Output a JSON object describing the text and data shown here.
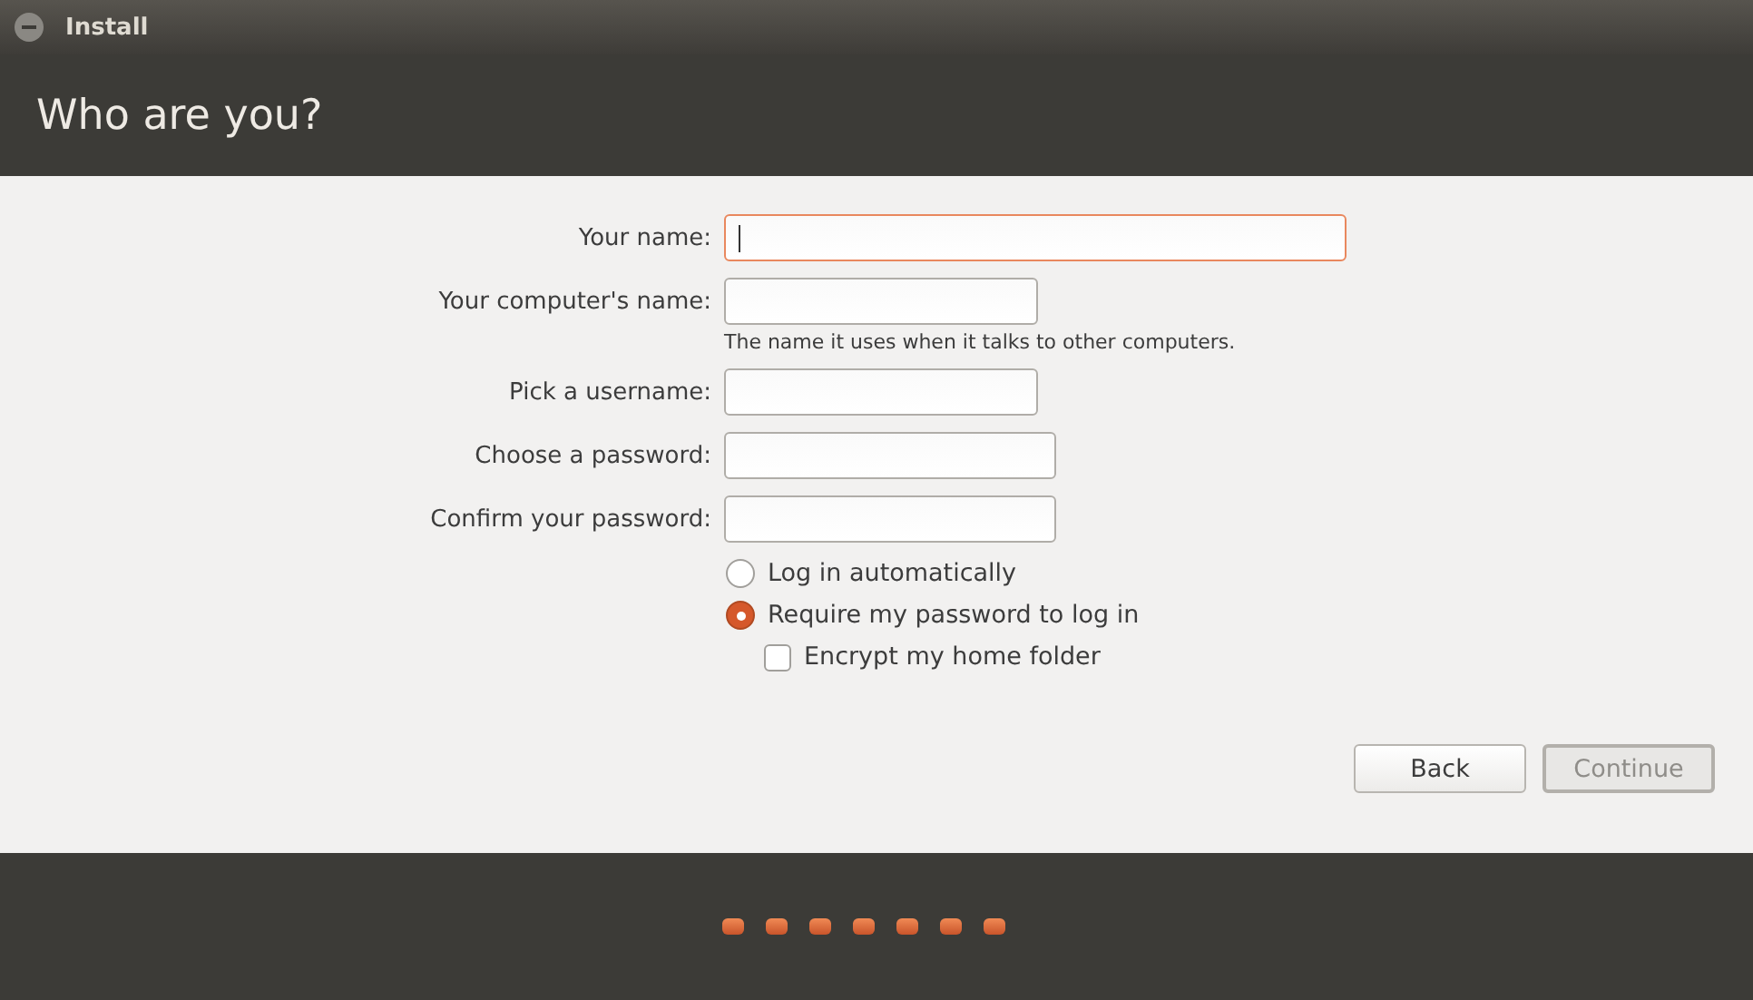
{
  "window": {
    "title": "Install"
  },
  "heading": "Who are you?",
  "fields": [
    {
      "label": "Your name:",
      "kind": "wide",
      "focused": true
    },
    {
      "label": "Your computer's name:",
      "kind": "short",
      "focused": false,
      "hint": "The name it uses when it talks to other computers."
    },
    {
      "label": "Pick a username:",
      "kind": "short",
      "focused": false
    },
    {
      "label": "Choose a password:",
      "kind": "medium",
      "focused": false
    },
    {
      "label": "Confirm your password:",
      "kind": "medium",
      "focused": false
    }
  ],
  "login_options": [
    {
      "label": "Log in automatically",
      "selected": false
    },
    {
      "label": "Require my password to log in",
      "selected": true
    }
  ],
  "encrypt": {
    "label": "Encrypt my home folder",
    "checked": false
  },
  "buttons": [
    {
      "label": "Back",
      "disabled": false
    },
    {
      "label": "Continue",
      "disabled": true
    }
  ],
  "progress_dots": [
    {
      "current": false
    },
    {
      "current": false
    },
    {
      "current": false
    },
    {
      "current": false
    },
    {
      "current": false
    },
    {
      "current": false
    },
    {
      "current": false
    }
  ]
}
